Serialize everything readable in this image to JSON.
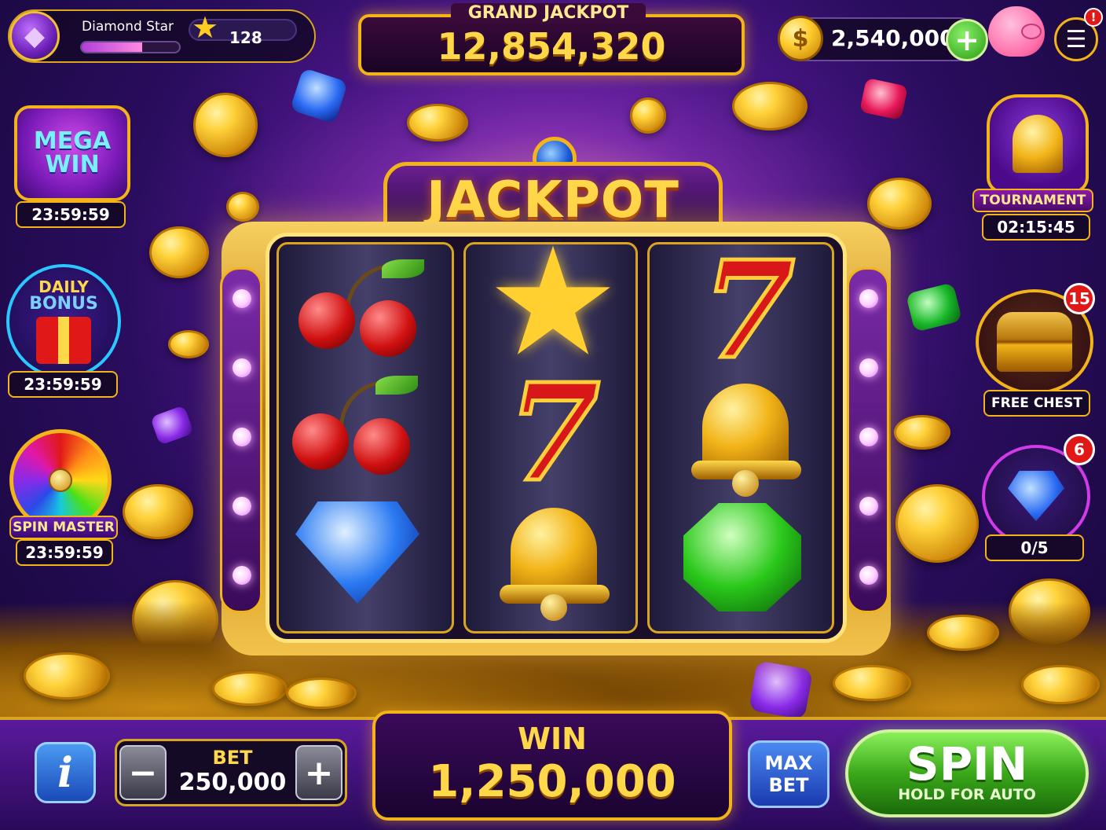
{
  "player": {
    "name": "Diamond Star",
    "level": "128",
    "xp_progress": 0.62
  },
  "jackpot": {
    "label": "GRAND JACKPOT",
    "value": "12,854,320"
  },
  "balance": {
    "coins": "2,540,000",
    "add_label": "+"
  },
  "menu": {
    "icon": "☰",
    "alert": "!"
  },
  "left_widgets": {
    "mega_win": {
      "title_line1": "MEGA",
      "title_line2": "WIN",
      "timer": "23:59:59"
    },
    "daily_bonus": {
      "title_line1": "DAILY",
      "title_line2": "BONUS",
      "timer": "23:59:59"
    },
    "spin_master": {
      "label": "SPIN MASTER",
      "timer": "23:59:59"
    }
  },
  "right_widgets": {
    "tournament": {
      "label": "TOURNAMENT",
      "timer": "02:15:45"
    },
    "free_chest": {
      "label": "FREE CHEST",
      "badge": "15"
    },
    "diamond_quest": {
      "progress": "0/5",
      "badge": "6"
    }
  },
  "machine": {
    "sign": "JACKPOT",
    "reels": [
      [
        "cherry",
        "cherry",
        "blue-diamond"
      ],
      [
        "star",
        "seven",
        "bell"
      ],
      [
        "seven",
        "bell",
        "green-gem"
      ]
    ],
    "seven_glyph": "7",
    "star_glyph": "★"
  },
  "controls": {
    "info_label": "i",
    "bet_label": "BET",
    "bet_value": "250,000",
    "bet_minus": "−",
    "bet_plus": "+",
    "win_label": "WIN",
    "win_value": "1,250,000",
    "maxbet_line1": "MAX",
    "maxbet_line2": "BET",
    "spin_label": "SPIN",
    "spin_sub": "HOLD FOR AUTO"
  },
  "colors": {
    "gold": "#f2b418",
    "purple": "#5a1a9c",
    "spin_green": "#3aa81a",
    "badge_red": "#e01818"
  }
}
